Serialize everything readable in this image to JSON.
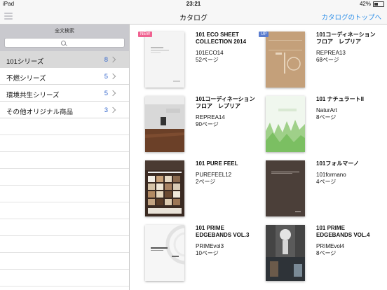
{
  "status": {
    "device": "iPad",
    "time": "23:21",
    "battery": "42%"
  },
  "nav": {
    "title": "カタログ",
    "right": "カタログのトップへ"
  },
  "sidebar": {
    "search_label": "全文検索",
    "items": [
      {
        "label": "101シリーズ",
        "count": "8",
        "selected": true
      },
      {
        "label": "不燃シリーズ",
        "count": "5"
      },
      {
        "label": "環境共生シリーズ",
        "count": "5"
      },
      {
        "label": "その他オリジナル商品",
        "count": "3"
      }
    ]
  },
  "catalogs": [
    {
      "title": "101 ECO SHEET COLLECTION 2014",
      "code": "101ECO14",
      "pages": "52ページ",
      "badge": "NEW"
    },
    {
      "title": "101コーディネーションフロア　レプリア",
      "code": "REPREA13",
      "pages": "68ページ",
      "badge": "UP"
    },
    {
      "title": "101コーディネーションフロア　レプリア",
      "code": "REPREA14",
      "pages": "90ページ"
    },
    {
      "title": "101 ナチュラートII",
      "code": "NaturArt",
      "pages": "8ページ"
    },
    {
      "title": "101 PURE FEEL",
      "code": "PUREFEEL12",
      "pages": "2ページ"
    },
    {
      "title": "101フォルマーノ",
      "code": "101formano",
      "pages": "4ページ"
    },
    {
      "title": "101 PRIME EDGEBANDS VOL.3",
      "code": "PRIMEvol3",
      "pages": "10ページ"
    },
    {
      "title": "101 PRIME EDGEBANDS VOL.4",
      "code": "PRIMEvol4",
      "pages": "8ページ"
    }
  ]
}
